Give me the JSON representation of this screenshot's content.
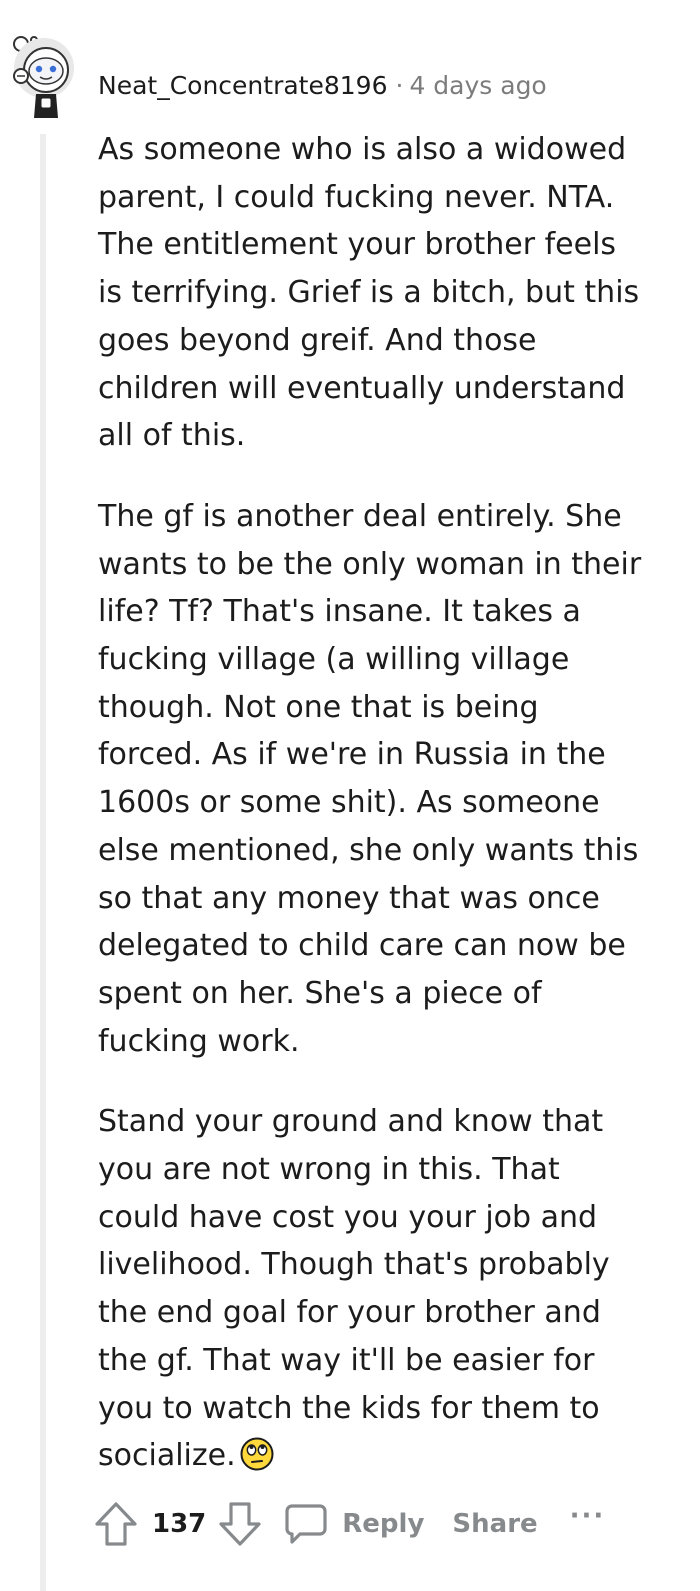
{
  "comment": {
    "username": "Neat_Concentrate8196",
    "separator": "·",
    "timestamp": "4 days ago",
    "paragraphs": [
      {
        "lines": [
          "As someone who is also a widowed",
          "parent, I could fucking never. NTA.",
          "The entitlement your brother feels",
          "is terrifying. Grief is a bitch, but this",
          "goes beyond greif. And those",
          "children will eventually understand",
          "all of this."
        ]
      },
      {
        "lines": [
          "The gf is another deal entirely. She",
          "wants to be the only woman in their",
          "life? Tf? That's insane. It takes a",
          "fucking village (a willing village",
          "though. Not one that is being",
          "forced. As if we're in Russia in the",
          "1600s or some shit). As someone",
          "else mentioned, she only wants this",
          "so that any money that was once",
          "delegated to child care can now be",
          "spent on her. She's a piece of",
          "fucking work."
        ]
      },
      {
        "lines": [
          "Stand your ground and know that",
          "you are not wrong in this. That",
          "could have cost you your job and",
          "livelihood. Though that's probably",
          "the end goal for your brother and",
          "the gf. That way it'll be easier for",
          "you to watch the kids for them to",
          "socialize."
        ]
      }
    ],
    "emoji_icon": "face-with-rolling-eyes"
  },
  "actions": {
    "score": "137",
    "reply_label": "Reply",
    "share_label": "Share",
    "more_label": "···"
  },
  "colors": {
    "text": "#1c1c1c",
    "meta": "#7c7c7c",
    "action": "#878a8c",
    "thread_line": "#ededed"
  }
}
